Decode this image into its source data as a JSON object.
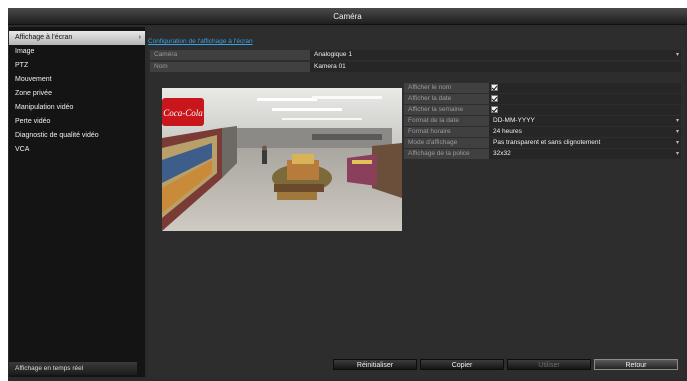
{
  "window": {
    "title": "Caméra"
  },
  "sidebar": {
    "items": [
      {
        "label": "Affichage à l'écran",
        "active": true
      },
      {
        "label": "Image"
      },
      {
        "label": "PTZ"
      },
      {
        "label": "Mouvement"
      },
      {
        "label": "Zone privée"
      },
      {
        "label": "Manipulation vidéo"
      },
      {
        "label": "Perte vidéo"
      },
      {
        "label": "Diagnostic de qualité vidéo"
      },
      {
        "label": "VCA"
      }
    ],
    "active_chevron": "›",
    "footer_label": "Affichage en temps réel"
  },
  "main": {
    "section_link": "Configuration de l'affichage à l'écran",
    "camera": {
      "label": "Caméra",
      "value": "Analogique 1"
    },
    "name": {
      "label": "Nom",
      "value": "Kamera 01"
    },
    "settings": [
      {
        "label": "Afficher le nom",
        "type": "checkbox",
        "checked": true
      },
      {
        "label": "Afficher la date",
        "type": "checkbox",
        "checked": true
      },
      {
        "label": "Afficher la semaine",
        "type": "checkbox",
        "checked": true
      },
      {
        "label": "Format de la date",
        "type": "select",
        "value": "DD-MM-YYYY"
      },
      {
        "label": "Format horaire",
        "type": "select",
        "value": "24 heures"
      },
      {
        "label": "Mode d'affichage",
        "type": "select",
        "value": "Pas transparent et sans clignotement"
      },
      {
        "label": "Affichage de la police",
        "type": "select",
        "value": "32x32"
      }
    ],
    "preview_sign": "Coca-Cola",
    "dropdown_icon": "chevron-down-icon"
  },
  "buttons": {
    "reset": "Réinitialiser",
    "copy": "Copier",
    "apply": "Utiliser",
    "back": "Retour"
  },
  "colors": {
    "link": "#3aa0e8",
    "sidebar_active": "#d0d0d0",
    "background": "#2b2b2b"
  }
}
